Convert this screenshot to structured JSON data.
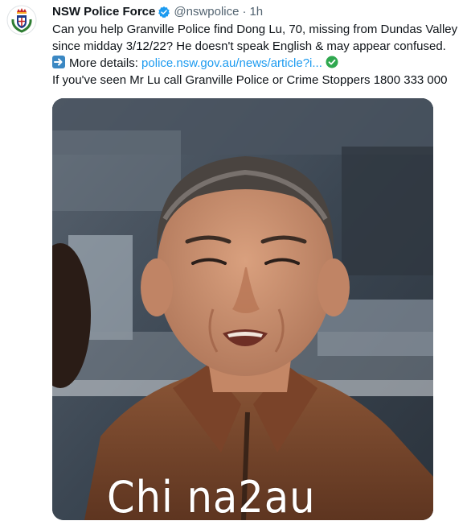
{
  "tweet": {
    "author_name": "NSW Police Force",
    "handle": "@nswpolice",
    "separator": "·",
    "time": "1h",
    "lines": [
      "Can you help Granville Police find Dong Lu, 70, missing from  Dundas Valley",
      "since midday 3/12/22? He doesn't speak English & may appear confused."
    ],
    "more_details_label": "More details:",
    "more_details_link": "police.nsw.gov.au/news/article?i...",
    "last_line": "If you've seen Mr Lu call Granville Police or Crime Stoppers 1800 333 000"
  },
  "watermark": "Chi na2au",
  "icons": {
    "avatar": "nsw-police-crest-icon",
    "verified": "verified-badge-icon",
    "arrow": "right-arrow-emoji-icon",
    "check": "check-mark-emoji-icon"
  },
  "colors": {
    "link": "#1d9bf0",
    "secondary_text": "#536471",
    "primary_text": "#0f1419",
    "verified": "#1d9bf0",
    "arrow_emoji_bg": "#3b88c3",
    "check_emoji_bg": "#2fa84f"
  }
}
